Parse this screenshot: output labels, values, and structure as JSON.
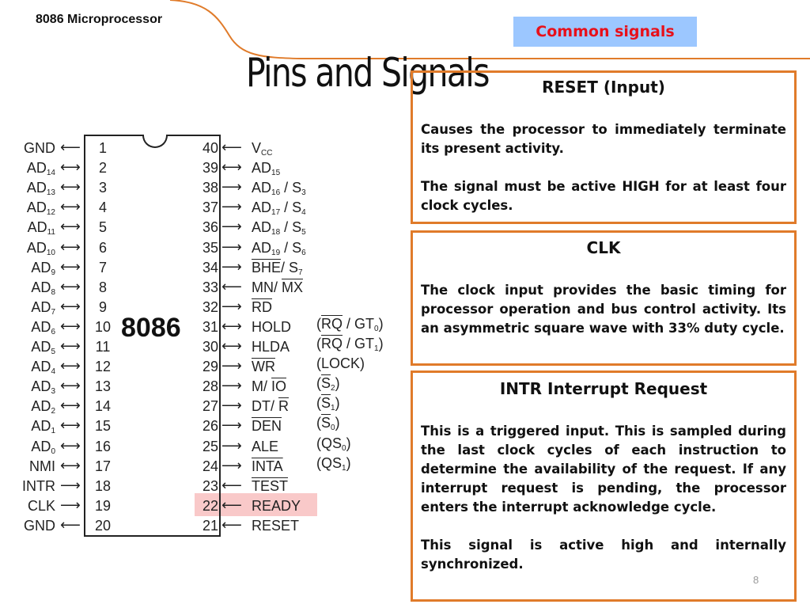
{
  "header": {
    "course": "8086 Microprocessor",
    "tag": "Common signals",
    "title": "Pins and Signals"
  },
  "colors": {
    "accent_orange": "#e07b2a",
    "tag_background": "#9cc7ff",
    "tag_text": "#e8101a",
    "highlight": "#f9c9c9"
  },
  "chip": {
    "name": "8086",
    "left_pins": [
      {
        "num": "1",
        "name": "GND",
        "sub": "",
        "dir": "out"
      },
      {
        "num": "2",
        "name": "AD",
        "sub": "14",
        "dir": "bi"
      },
      {
        "num": "3",
        "name": "AD",
        "sub": "13",
        "dir": "bi"
      },
      {
        "num": "4",
        "name": "AD",
        "sub": "12",
        "dir": "bi"
      },
      {
        "num": "5",
        "name": "AD",
        "sub": "11",
        "dir": "bi"
      },
      {
        "num": "6",
        "name": "AD",
        "sub": "10",
        "dir": "bi"
      },
      {
        "num": "7",
        "name": "AD",
        "sub": "9",
        "dir": "bi"
      },
      {
        "num": "8",
        "name": "AD",
        "sub": "8",
        "dir": "bi"
      },
      {
        "num": "9",
        "name": "AD",
        "sub": "7",
        "dir": "bi"
      },
      {
        "num": "10",
        "name": "AD",
        "sub": "6",
        "dir": "bi"
      },
      {
        "num": "11",
        "name": "AD",
        "sub": "5",
        "dir": "bi"
      },
      {
        "num": "12",
        "name": "AD",
        "sub": "4",
        "dir": "bi"
      },
      {
        "num": "13",
        "name": "AD",
        "sub": "3",
        "dir": "bi"
      },
      {
        "num": "14",
        "name": "AD",
        "sub": "2",
        "dir": "bi"
      },
      {
        "num": "15",
        "name": "AD",
        "sub": "1",
        "dir": "bi"
      },
      {
        "num": "16",
        "name": "AD",
        "sub": "0",
        "dir": "bi"
      },
      {
        "num": "17",
        "name": "NMI",
        "sub": "",
        "dir": "bi"
      },
      {
        "num": "18",
        "name": "INTR",
        "sub": "",
        "dir": "in"
      },
      {
        "num": "19",
        "name": "CLK",
        "sub": "",
        "dir": "in"
      },
      {
        "num": "20",
        "name": "GND",
        "sub": "",
        "dir": "out"
      }
    ],
    "right_pins": [
      {
        "num": "40",
        "html": "V<sub>CC</sub>",
        "dir": "in",
        "alt": ""
      },
      {
        "num": "39",
        "html": "AD<sub>15</sub>",
        "dir": "bi",
        "alt": ""
      },
      {
        "num": "38",
        "html": "AD<sub>16</sub> / S<sub>3</sub>",
        "dir": "out",
        "alt": ""
      },
      {
        "num": "37",
        "html": "AD<sub>17</sub> / S<sub>4</sub>",
        "dir": "out",
        "alt": ""
      },
      {
        "num": "36",
        "html": "AD<sub>18</sub> / S<sub>5</sub>",
        "dir": "out",
        "alt": ""
      },
      {
        "num": "35",
        "html": "AD<sub>19</sub> / S<sub>6</sub>",
        "dir": "out",
        "alt": ""
      },
      {
        "num": "34",
        "html": "<span style=\"text-decoration:overline\">BHE</span>/ S<sub>7</sub>",
        "dir": "out",
        "alt": ""
      },
      {
        "num": "33",
        "html": "MN/ <span style=\"text-decoration:overline\">MX</span>",
        "dir": "in",
        "alt": ""
      },
      {
        "num": "32",
        "html": "<span style=\"text-decoration:overline\">RD</span>",
        "dir": "out",
        "alt": ""
      },
      {
        "num": "31",
        "html": "HOLD",
        "dir": "bi",
        "alt": "(<span style=\"text-decoration:overline\">RQ</span> / GT<sub>0</sub>)"
      },
      {
        "num": "30",
        "html": "HLDA",
        "dir": "bi",
        "alt": "(<span style=\"text-decoration:overline\">RQ</span> / GT<sub>1</sub>)"
      },
      {
        "num": "29",
        "html": "<span style=\"text-decoration:overline\">WR</span>",
        "dir": "out",
        "alt": "(LOCK)"
      },
      {
        "num": "28",
        "html": "M/ <span style=\"text-decoration:overline\">IO</span>",
        "dir": "out",
        "alt": "(<span style=\"text-decoration:overline\">S</span><sub>2</sub>)"
      },
      {
        "num": "27",
        "html": "DT/ <span style=\"text-decoration:overline\">R</span>",
        "dir": "out",
        "alt": "(<span style=\"text-decoration:overline\">S</span><sub>1</sub>)"
      },
      {
        "num": "26",
        "html": "<span style=\"text-decoration:overline\">DEN</span>",
        "dir": "out",
        "alt": "(<span style=\"text-decoration:overline\">S</span><sub>0</sub>)"
      },
      {
        "num": "25",
        "html": "ALE",
        "dir": "out",
        "alt": "(QS<sub>0</sub>)"
      },
      {
        "num": "24",
        "html": "<span style=\"text-decoration:overline\">INTA</span>",
        "dir": "out",
        "alt": "(QS<sub>1</sub>)"
      },
      {
        "num": "23",
        "html": "<span style=\"text-decoration:overline\">TEST</span>",
        "dir": "in",
        "alt": ""
      },
      {
        "num": "22",
        "html": "READY",
        "dir": "in",
        "alt": "",
        "highlight": true
      },
      {
        "num": "21",
        "html": "RESET",
        "dir": "in",
        "alt": ""
      }
    ]
  },
  "boxes": [
    {
      "title": "RESET (Input)",
      "paragraphs": [
        "Causes the processor to immediately terminate its present  activity.",
        "The signal must be active HIGH for at least four clock cycles."
      ]
    },
    {
      "title": "CLK",
      "paragraphs": [
        "The clock input provides the basic timing for processor operation and bus control activity. Its an asymmetric square wave with 33% duty cycle."
      ]
    },
    {
      "title": "INTR Interrupt Request",
      "paragraphs": [
        "This is a triggered input. This is sampled during the last clock cycles of each instruction to determine the availability of the request. If any interrupt request is pending, the processor enters the interrupt acknowledge cycle.",
        "This signal is active high and internally synchronized."
      ]
    }
  ],
  "footer": {
    "page_number": "8"
  }
}
